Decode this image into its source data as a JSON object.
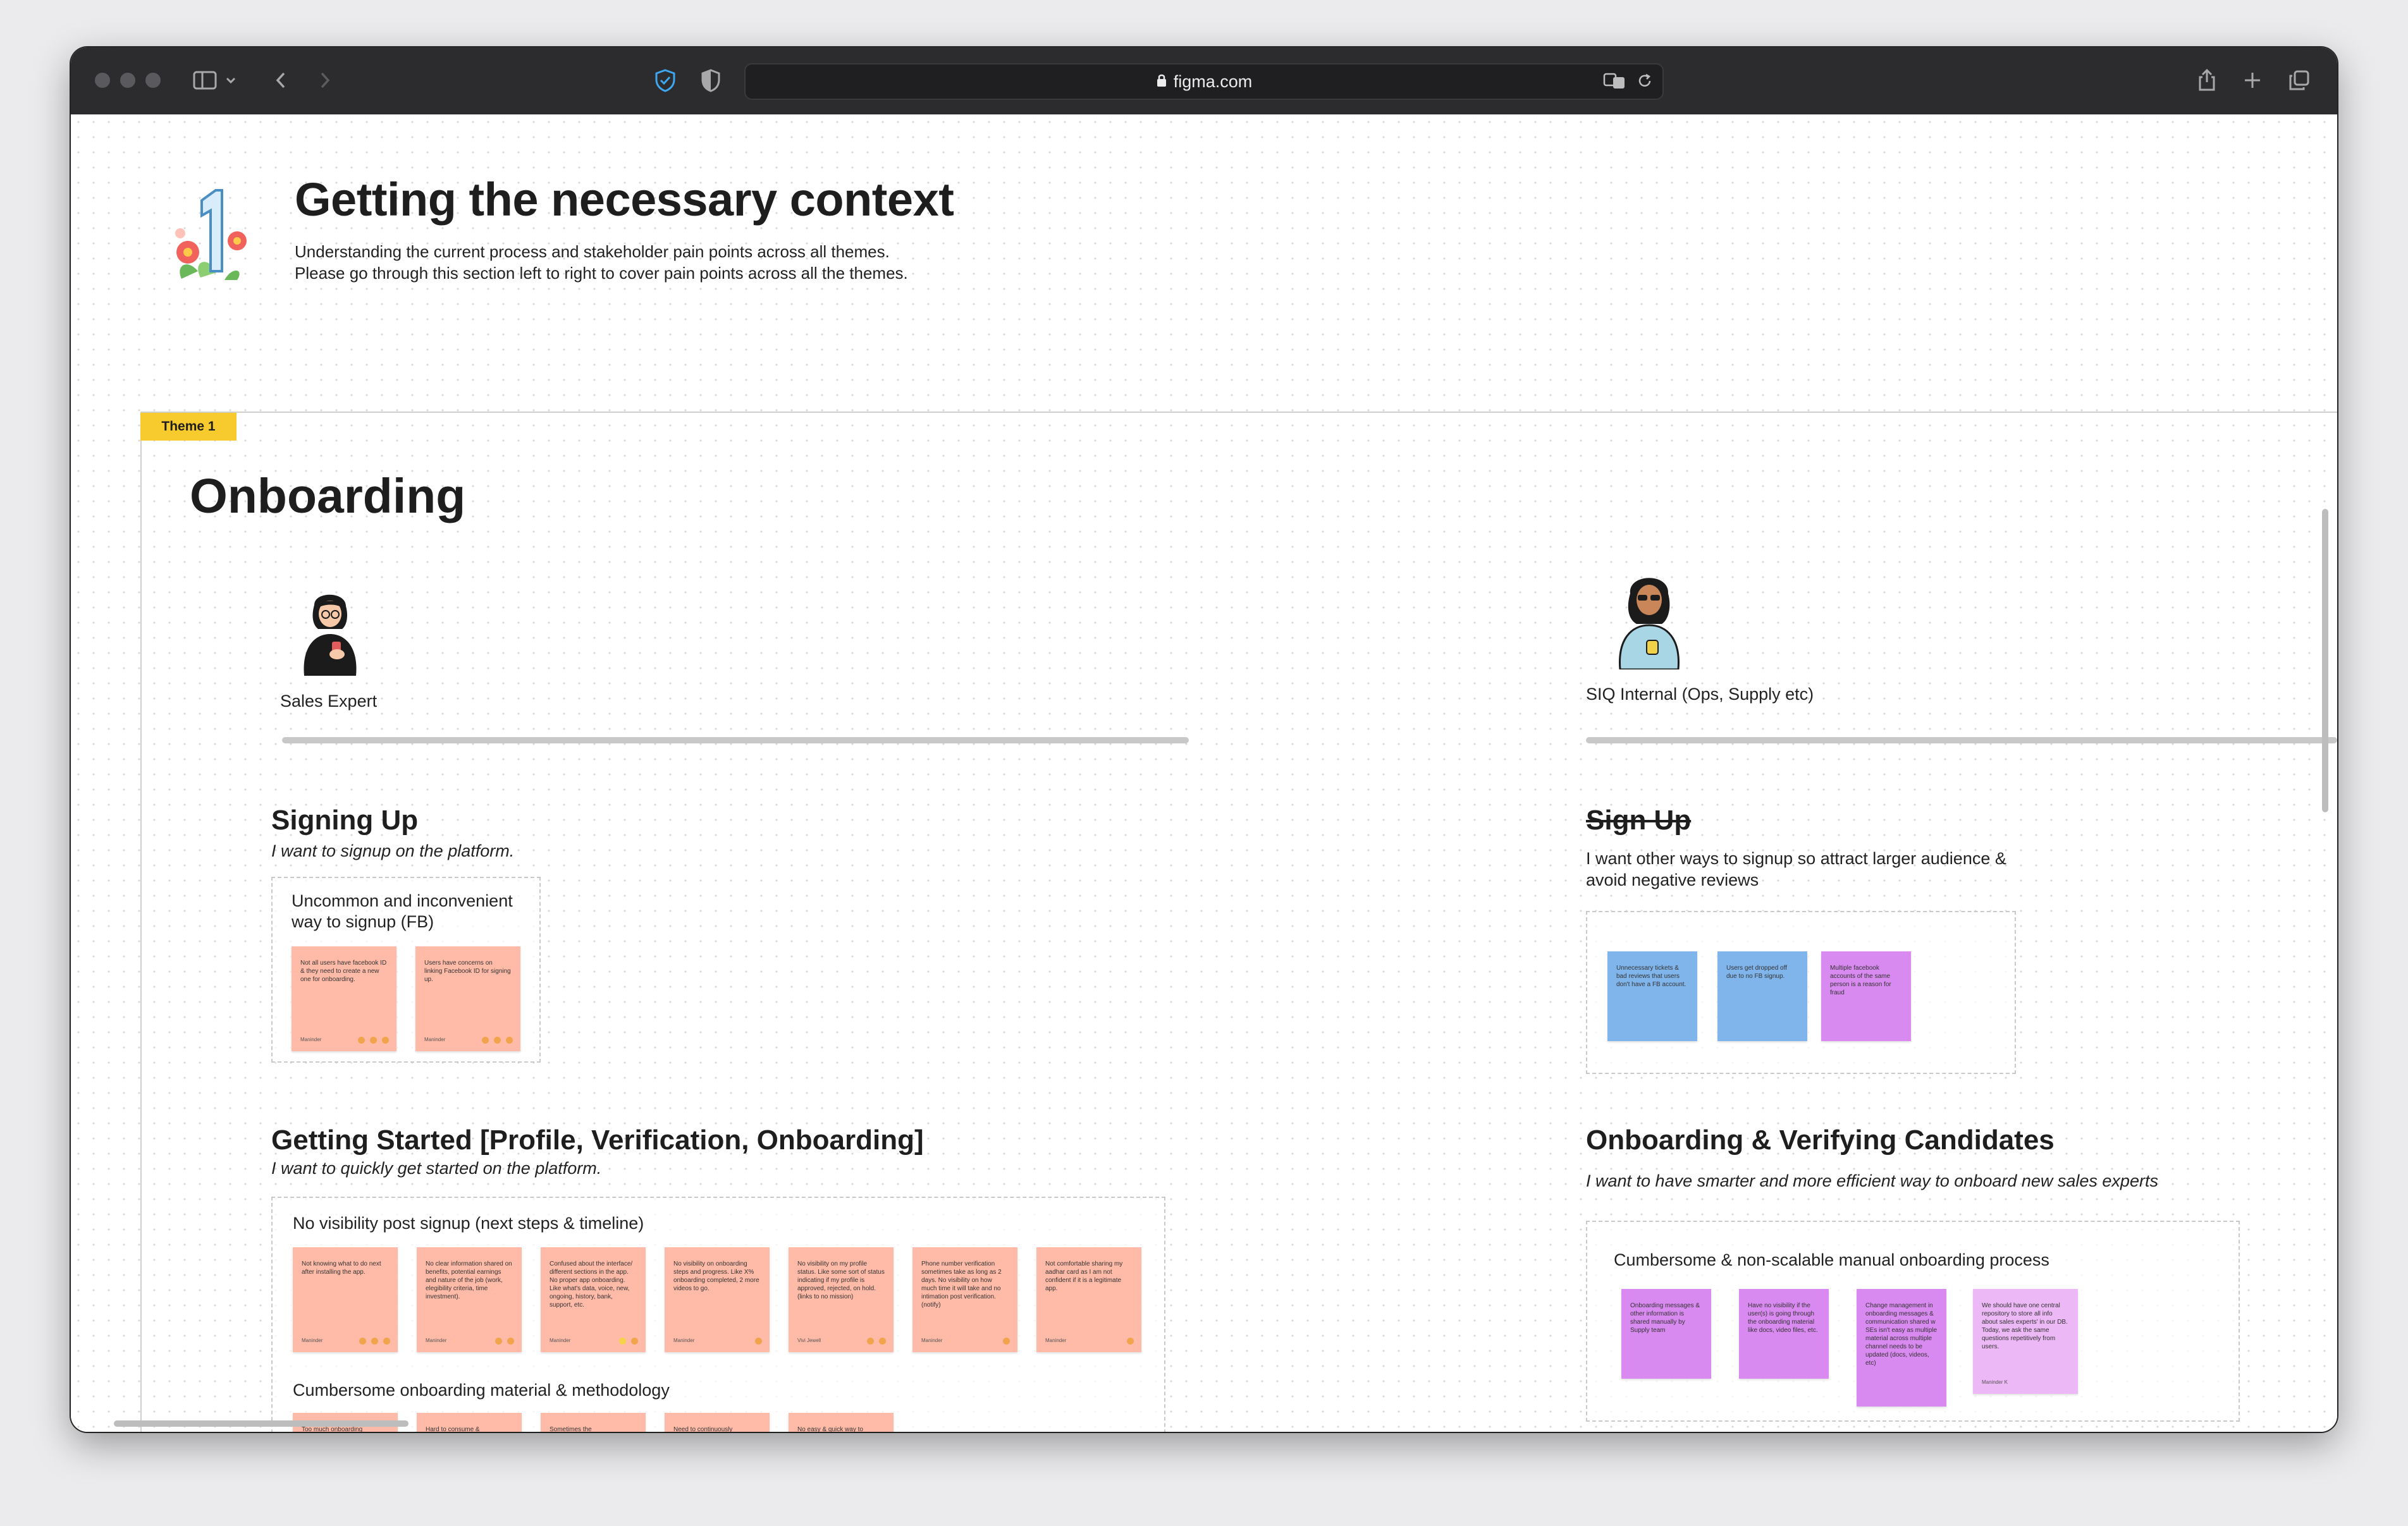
{
  "browser": {
    "url": "figma.com"
  },
  "header": {
    "title": "Getting the necessary context",
    "line1": "Understanding the current process and stakeholder pain points across all themes.",
    "line2": "Please go through this section left to right to cover pain points across all the themes.",
    "number_badge": "1"
  },
  "theme": {
    "tag": "Theme 1",
    "title": "Onboarding"
  },
  "personas": {
    "left": {
      "label": "Sales Expert"
    },
    "right": {
      "label": "SIQ Internal (Ops, Supply etc)"
    }
  },
  "left_column": {
    "signing_up": {
      "title": "Signing Up",
      "subtitle": "I want to signup on the platform.",
      "box_title": "Uncommon and inconvenient way to signup (FB)",
      "notes": [
        "Not all users have facebook ID & they need to create a new one for onboarding.",
        "Users have concerns on linking Facebook ID for signing up."
      ]
    },
    "getting_started": {
      "title": "Getting Started [Profile, Verification, Onboarding]",
      "subtitle": "I want to quickly get started on the platform.",
      "box1_title": "No visibility post signup (next steps & timeline)",
      "notes": [
        "Not knowing what to do next after installing the app.",
        "No clear information shared on benefits, potential earnings and nature of the job (work, elegibility criteria, time investment).",
        "Confused about the interface/ different sections in the app. No proper app onboarding. Like what's data, voice, new, ongoing, history, bank, support, etc.",
        "No visibility on onboarding steps and progress. Like X% onboarding completed, 2 more videos to go.",
        "No visibility on my profile status. Like some sort of status indicating if my profile is approved, rejected, on hold. (links to no mission)",
        "Phone number verification sometimes take as long as 2 days. No visibility on how much time it will take and no intimation post verification. (notify)",
        "Not comfortable sharing my aadhar card as I am not confident if it is a legitimate app."
      ],
      "box2_title": "Cumbersome onboarding material & methodology",
      "notes2": [
        "Too much onboarding",
        "Hard to consume &",
        "Sometimes the",
        "Need to continuously",
        "No easy & quick way to"
      ]
    },
    "note_author": "Maninder",
    "note_author_alt": "Vivi Jewell"
  },
  "right_column": {
    "sign_up": {
      "title": "Sign Up",
      "subtitle": "I want other ways to signup so attract larger audience & avoid negative reviews",
      "notes": [
        "Unnecessary tickets & bad reviews that users don't have a FB account.",
        "Users get dropped off due to no FB signup.",
        "Multiple facebook accounts of the same person is a reason for fraud"
      ]
    },
    "onboarding_verifying": {
      "title": "Onboarding & Verifying Candidates",
      "subtitle": "I want to have smarter and more efficient way to onboard new sales experts",
      "box_title": "Cumbersome & non-scalable manual onboarding process",
      "notes": [
        "Onboarding messages & other information is shared manually by Supply team",
        "Have no visibility if the user(s) is going through the onboarding material like docs, video files, etc.",
        "Change management in onboarding messages & communication shared w SEs isn't easy as multiple material across multiple channel needs to be updated (docs, videos, etc)",
        "We should have one central repository to store all info about sales experts' in our DB. Today, we ask the same questions repetitively from users."
      ],
      "note_author": "Maninder K"
    }
  }
}
